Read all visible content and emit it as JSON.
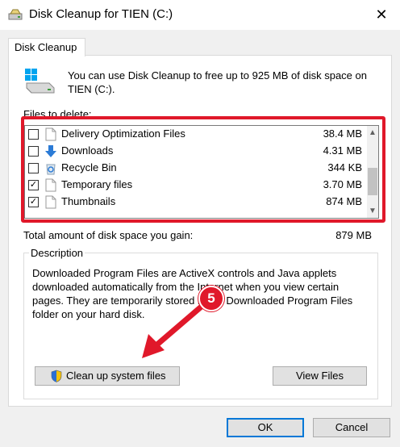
{
  "window": {
    "title": "Disk Cleanup for TIEN (C:)",
    "close_glyph": "✕"
  },
  "tab": {
    "label": "Disk Cleanup"
  },
  "intro": "You can use Disk Cleanup to free up to 925 MB of disk space on TIEN (C:).",
  "files_label": "Files to delete:",
  "files": [
    {
      "name": "Delivery Optimization Files",
      "size": "38.4 MB",
      "checked": false,
      "icon": "file-icon"
    },
    {
      "name": "Downloads",
      "size": "4.31 MB",
      "checked": false,
      "icon": "download-arrow-icon"
    },
    {
      "name": "Recycle Bin",
      "size": "344 KB",
      "checked": false,
      "icon": "recycle-bin-icon"
    },
    {
      "name": "Temporary files",
      "size": "3.70 MB",
      "checked": true,
      "icon": "file-icon"
    },
    {
      "name": "Thumbnails",
      "size": "874 MB",
      "checked": true,
      "icon": "file-icon"
    }
  ],
  "total": {
    "label": "Total amount of disk space you gain:",
    "value": "879 MB"
  },
  "description": {
    "legend": "Description",
    "text": "Downloaded Program Files are ActiveX controls and Java applets downloaded automatically from the Internet when you view certain pages. They are temporarily stored in the Downloaded Program Files folder on your hard disk."
  },
  "buttons": {
    "cleanup": "Clean up system files",
    "view_files": "View Files",
    "ok": "OK",
    "cancel": "Cancel"
  },
  "annotation": {
    "step": "5",
    "color": "#e0182a"
  },
  "colors": {
    "accent": "#0078d7",
    "highlight": "#e0182a"
  }
}
